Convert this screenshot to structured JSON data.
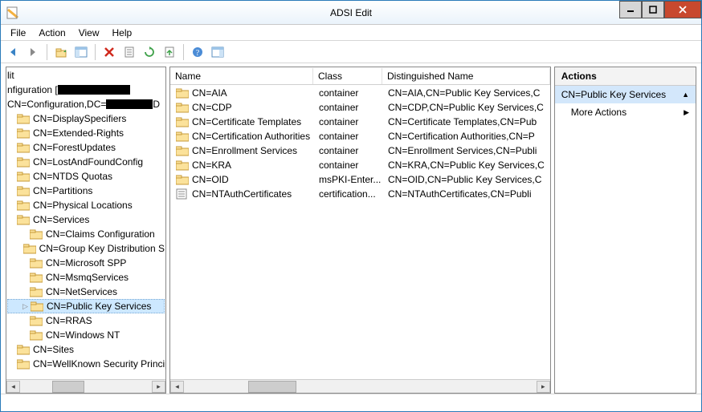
{
  "window": {
    "title": "ADSI Edit"
  },
  "menus": {
    "file": "File",
    "action": "Action",
    "view": "View",
    "help": "Help"
  },
  "tree": {
    "root": "lit",
    "config_prefix": "nfiguration [",
    "config_full": "CN=Configuration,DC=",
    "items": [
      "CN=DisplaySpecifiers",
      "CN=Extended-Rights",
      "CN=ForestUpdates",
      "CN=LostAndFoundConfig",
      "CN=NTDS Quotas",
      "CN=Partitions",
      "CN=Physical Locations"
    ],
    "services": "CN=Services",
    "services_children": [
      "CN=Claims Configuration",
      "CN=Group Key Distribution S",
      "CN=Microsoft SPP",
      "CN=MsmqServices",
      "CN=NetServices",
      "CN=Public Key Services",
      "CN=RRAS",
      "CN=Windows NT"
    ],
    "tail": [
      "CN=Sites",
      "CN=WellKnown Security Principa"
    ]
  },
  "list": {
    "headers": {
      "name": "Name",
      "class": "Class",
      "dn": "Distinguished Name"
    },
    "rows": [
      {
        "name": "CN=AIA",
        "class": "container",
        "dn": "CN=AIA,CN=Public Key Services,C",
        "icon": "folder"
      },
      {
        "name": "CN=CDP",
        "class": "container",
        "dn": "CN=CDP,CN=Public Key Services,C",
        "icon": "folder"
      },
      {
        "name": "CN=Certificate Templates",
        "class": "container",
        "dn": "CN=Certificate Templates,CN=Pub",
        "icon": "folder"
      },
      {
        "name": "CN=Certification Authorities",
        "class": "container",
        "dn": "CN=Certification Authorities,CN=P",
        "icon": "folder"
      },
      {
        "name": "CN=Enrollment Services",
        "class": "container",
        "dn": "CN=Enrollment Services,CN=Publi",
        "icon": "folder"
      },
      {
        "name": "CN=KRA",
        "class": "container",
        "dn": "CN=KRA,CN=Public Key Services,C",
        "icon": "folder"
      },
      {
        "name": "CN=OID",
        "class": "msPKI-Enter...",
        "dn": "CN=OID,CN=Public Key Services,C",
        "icon": "folder"
      },
      {
        "name": "CN=NTAuthCertificates",
        "class": "certification...",
        "dn": "CN=NTAuthCertificates,CN=Publi",
        "icon": "cert"
      }
    ]
  },
  "actions": {
    "header": "Actions",
    "selected": "CN=Public Key Services",
    "more": "More Actions"
  }
}
